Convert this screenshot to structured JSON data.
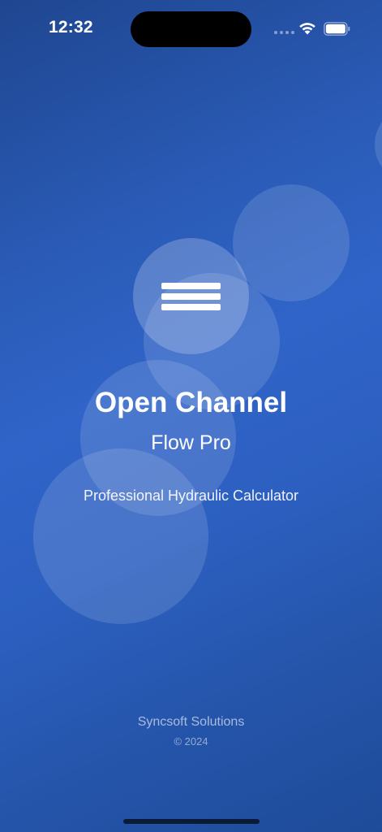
{
  "status_bar": {
    "time": "12:32",
    "wifi_icon": "wifi-icon",
    "battery_icon": "battery-icon",
    "signal_icon": "cellular-signal-dots-icon"
  },
  "splash": {
    "logo_icon": "horizontal-lines-logo-icon",
    "title": "Open Channel",
    "subtitle": "Flow Pro",
    "tagline": "Professional Hydraulic Calculator",
    "company": "Syncsoft Solutions",
    "copyright": "© 2024"
  },
  "colors": {
    "background_top": "#1f4690",
    "background_mid": "#3064c8",
    "background_bottom": "#1e4b99",
    "text": "#ffffff"
  }
}
